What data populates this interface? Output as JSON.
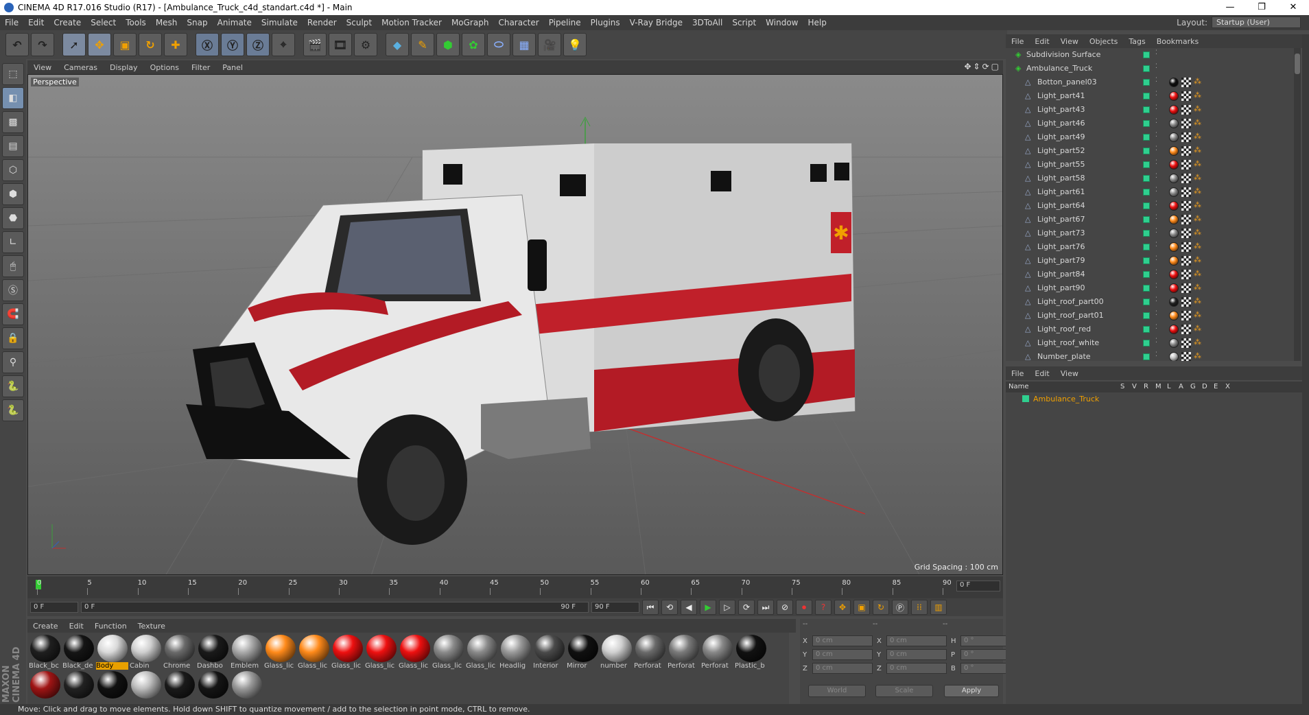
{
  "window": {
    "title": "CINEMA 4D R17.016 Studio (R17) - [Ambulance_Truck_c4d_standart.c4d *] - Main",
    "controls": [
      "—",
      "❐",
      "✕"
    ]
  },
  "menu": [
    "File",
    "Edit",
    "Create",
    "Select",
    "Tools",
    "Mesh",
    "Snap",
    "Animate",
    "Simulate",
    "Render",
    "Sculpt",
    "Motion Tracker",
    "MoGraph",
    "Character",
    "Pipeline",
    "Plugins",
    "V-Ray Bridge",
    "3DToAll",
    "Script",
    "Window",
    "Help"
  ],
  "layout": {
    "label": "Layout:",
    "value": "Startup (User)"
  },
  "viewport": {
    "menu": [
      "View",
      "Cameras",
      "Display",
      "Options",
      "Filter",
      "Panel"
    ],
    "camera_label": "Perspective",
    "grid_spacing": "Grid Spacing : 100 cm",
    "nav_icons": [
      "✥",
      "⇕",
      "⟳",
      "▢"
    ]
  },
  "timeline": {
    "ticks": [
      "0",
      "5",
      "10",
      "15",
      "20",
      "25",
      "30",
      "35",
      "40",
      "45",
      "50",
      "55",
      "60",
      "65",
      "70",
      "75",
      "80",
      "85",
      "90"
    ],
    "current": "0 F",
    "start": "0 F",
    "range_start": "0 F",
    "range_end": "90 F",
    "end": "90 F"
  },
  "materials": {
    "menu": [
      "Create",
      "Edit",
      "Function",
      "Texture"
    ],
    "items": [
      {
        "name": "Black_bc",
        "color": "#1f1f1f"
      },
      {
        "name": "Black_de",
        "color": "#151515"
      },
      {
        "name": "Body",
        "color": "#d9d9d9",
        "selected": true
      },
      {
        "name": "Cabin",
        "color": "#cfcfcf"
      },
      {
        "name": "Chrome",
        "color": "#6a6a6a"
      },
      {
        "name": "Dashbo",
        "color": "#1a1a1a"
      },
      {
        "name": "Emblem",
        "color": "#aaaaaa"
      },
      {
        "name": "Glass_lic",
        "color": "#ff8a1a"
      },
      {
        "name": "Glass_lic",
        "color": "#ff8a1a"
      },
      {
        "name": "Glass_lic",
        "color": "#ee1010"
      },
      {
        "name": "Glass_lic",
        "color": "#ee1010"
      },
      {
        "name": "Glass_lic",
        "color": "#ee1010"
      },
      {
        "name": "Glass_lic",
        "color": "#8a8a8a"
      },
      {
        "name": "Glass_lic",
        "color": "#8a8a8a"
      },
      {
        "name": "Headlig",
        "color": "#9a9a9a"
      },
      {
        "name": "Interior",
        "color": "#4a4a4a"
      },
      {
        "name": "Mirror",
        "color": "#101010"
      },
      {
        "name": "number",
        "color": "#d0d0d0"
      },
      {
        "name": "Perforat",
        "color": "#6a6a6a"
      },
      {
        "name": "Perforat",
        "color": "#7a7a7a"
      },
      {
        "name": "Perforat",
        "color": "#888888"
      },
      {
        "name": "Plastic_b",
        "color": "#111111"
      },
      {
        "name": "",
        "color": "#a01515"
      },
      {
        "name": "",
        "color": "#222222"
      },
      {
        "name": "",
        "color": "#111111"
      },
      {
        "name": "",
        "color": "#bdbdbd"
      },
      {
        "name": "",
        "color": "#1a1a1a"
      },
      {
        "name": "",
        "color": "#151515"
      },
      {
        "name": "",
        "color": "#9a9a9a"
      }
    ]
  },
  "coordinates": {
    "headers": [
      "--",
      "--",
      "--"
    ],
    "rows": [
      {
        "a": "X",
        "av": "0 cm",
        "b": "X",
        "bv": "0 cm",
        "c": "H",
        "cv": "0 °"
      },
      {
        "a": "Y",
        "av": "0 cm",
        "b": "Y",
        "bv": "0 cm",
        "c": "P",
        "cv": "0 °"
      },
      {
        "a": "Z",
        "av": "0 cm",
        "b": "Z",
        "bv": "0 cm",
        "c": "B",
        "cv": "0 °"
      }
    ],
    "world": "World",
    "scale": "Scale",
    "apply": "Apply"
  },
  "objects_panel": {
    "menu": [
      "File",
      "Edit",
      "View",
      "Objects",
      "Tags",
      "Bookmarks"
    ],
    "items": [
      {
        "name": "Subdivision Surface",
        "level": 0,
        "tag": ""
      },
      {
        "name": "Ambulance_Truck",
        "level": 0,
        "tag": ""
      },
      {
        "name": "Botton_panel03",
        "level": 1,
        "tag": "#111111"
      },
      {
        "name": "Light_part41",
        "level": 1,
        "tag": "#ee1010"
      },
      {
        "name": "Light_part43",
        "level": 1,
        "tag": "#ee1010"
      },
      {
        "name": "Light_part46",
        "level": 1,
        "tag": "#8a8a8a"
      },
      {
        "name": "Light_part49",
        "level": 1,
        "tag": "#8a8a8a"
      },
      {
        "name": "Light_part52",
        "level": 1,
        "tag": "#ff8a1a"
      },
      {
        "name": "Light_part55",
        "level": 1,
        "tag": "#ee1010"
      },
      {
        "name": "Light_part58",
        "level": 1,
        "tag": "#8a8a8a"
      },
      {
        "name": "Light_part61",
        "level": 1,
        "tag": "#8a8a8a"
      },
      {
        "name": "Light_part64",
        "level": 1,
        "tag": "#ee1010"
      },
      {
        "name": "Light_part67",
        "level": 1,
        "tag": "#ff8a1a"
      },
      {
        "name": "Light_part73",
        "level": 1,
        "tag": "#8a8a8a"
      },
      {
        "name": "Light_part76",
        "level": 1,
        "tag": "#ff8a1a"
      },
      {
        "name": "Light_part79",
        "level": 1,
        "tag": "#ff8a1a"
      },
      {
        "name": "Light_part84",
        "level": 1,
        "tag": "#ee1010"
      },
      {
        "name": "Light_part90",
        "level": 1,
        "tag": "#ee1010"
      },
      {
        "name": "Light_roof_part00",
        "level": 1,
        "tag": "#222222"
      },
      {
        "name": "Light_roof_part01",
        "level": 1,
        "tag": "#ff8a1a"
      },
      {
        "name": "Light_roof_red",
        "level": 1,
        "tag": "#ee1010"
      },
      {
        "name": "Light_roof_white",
        "level": 1,
        "tag": "#8a8a8a"
      },
      {
        "name": "Number_plate",
        "level": 1,
        "tag": "#c0c0c0"
      }
    ]
  },
  "layers_panel": {
    "menu": [
      "File",
      "Edit",
      "View"
    ],
    "columns": [
      "Name",
      "S",
      "V",
      "R",
      "M",
      "L",
      "A",
      "G",
      "D",
      "E",
      "X"
    ],
    "row": "Ambulance_Truck"
  },
  "status": "Move: Click and drag to move elements. Hold down SHIFT to quantize movement / add to the selection in point mode, CTRL to remove.",
  "brand": "MAXON CINEMA 4D"
}
